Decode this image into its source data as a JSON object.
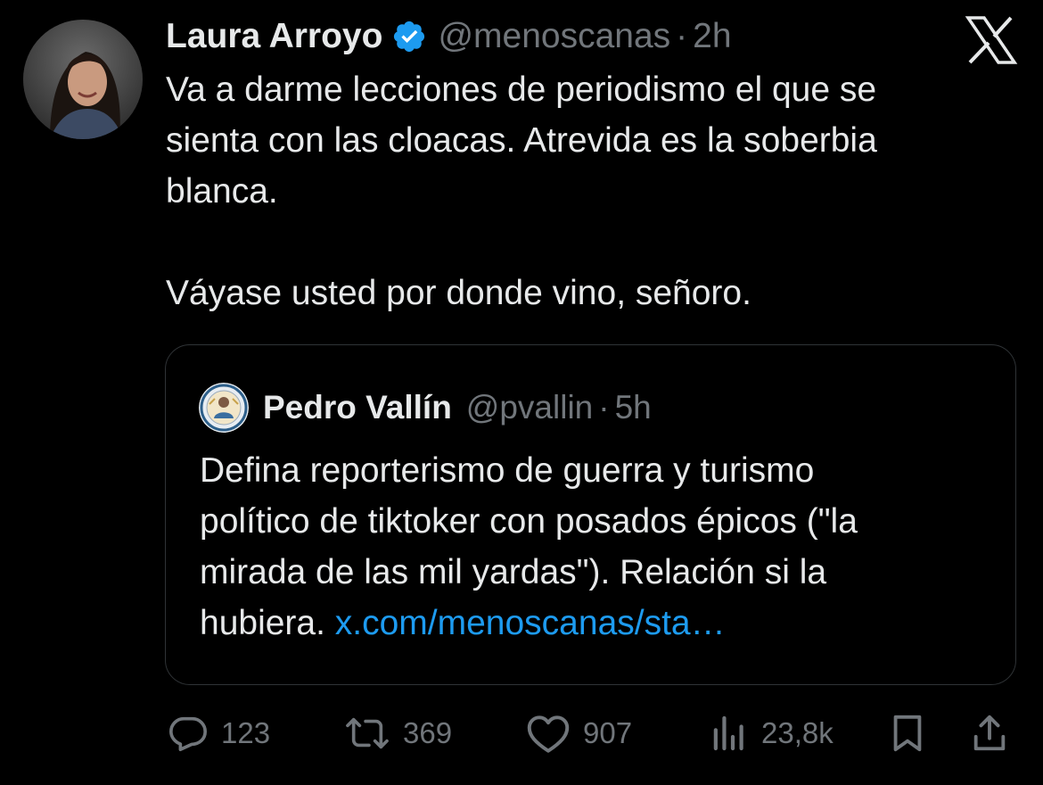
{
  "tweet": {
    "author": {
      "name": "Laura Arroyo",
      "handle": "@menoscanas",
      "separator": "·",
      "time": "2h",
      "verified": true
    },
    "body": {
      "line1": "Va a darme lecciones de periodismo el que se",
      "line2": "sienta con las cloacas. Atrevida es la soberbia",
      "line3": "blanca.",
      "line4": "Váyase usted por donde vino, señoro."
    },
    "quote": {
      "author": {
        "name": "Pedro Vallín",
        "handle": "@pvallin",
        "separator": "·",
        "time": "5h"
      },
      "text": {
        "line1": "Defina reporterismo de guerra y turismo",
        "line2": "político de tiktoker con posados épicos (\"la",
        "line3": "mirada de las mil yardas\"). Relación si la",
        "line4_prefix": "hubiera. ",
        "link": "x.com/menoscanas/sta…"
      }
    },
    "actions": {
      "replies": "123",
      "reposts": "369",
      "likes": "907",
      "views": "23,8k"
    }
  },
  "icons": {
    "close": "x-logo-icon",
    "verified": "verified-badge-icon",
    "reply": "reply-icon",
    "repost": "repost-icon",
    "like": "heart-icon",
    "views": "views-icon",
    "bookmark": "bookmark-icon",
    "share": "share-icon"
  },
  "colors": {
    "background": "#000000",
    "text": "#e7e9ea",
    "secondary": "#71767b",
    "link": "#1d9bf0",
    "verified": "#1d9bf0",
    "border": "#2f3336"
  }
}
